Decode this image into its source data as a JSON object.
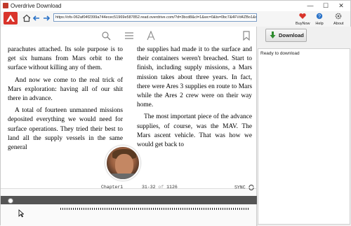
{
  "window": {
    "title": "Overdrive Download",
    "minimize": "—",
    "maximize": "☐",
    "close": "✕"
  },
  "toolbar": {
    "url": "https://ofs-062af04f2399a744ecec51969e587852.read.overdrive.com/?d=3bcd8&cl=1&wc=0&ts=0bc7&4FVd4ZBo1&rd",
    "buttons": [
      {
        "label": "BuyNow",
        "icon": "heart-icon"
      },
      {
        "label": "Help",
        "icon": "help-icon"
      },
      {
        "label": "About",
        "icon": "gear-icon"
      }
    ]
  },
  "reader": {
    "col1": [
      {
        "text": "parachutes attached. Its sole purpose is to get six humans from Mars orbit to the surface without killing any of them.",
        "indent": false
      },
      {
        "text": "And now we come to the real trick of Mars exploration: having all of our shit there in advance.",
        "indent": true
      },
      {
        "text": "A total of fourteen unmanned missions deposited everything we would need for surface operations. They tried their best to land all the supply vessels in the same general",
        "indent": true
      }
    ],
    "col2": [
      {
        "text": "the supplies had made it to the surface and their containers weren't breached. Start to finish, including supply missions, a Mars mission takes about three years. In fact, there were Ares 3 supplies en route to Mars while the Ares 2 crew were on their way home.",
        "indent": false
      },
      {
        "text": "The most important piece of the advance supplies, of course, was the MAV. The Mars ascent vehicle. That was how we would get back to",
        "indent": true
      }
    ],
    "chapter": "Chapter1",
    "pages": "31-32",
    "of": "of",
    "total": "1126",
    "sync": "SYNC"
  },
  "side": {
    "download_label": "Download",
    "status": "Ready to download"
  },
  "colors": {
    "accent": "#d9342b",
    "download_arrow": "#2e8b2e"
  }
}
